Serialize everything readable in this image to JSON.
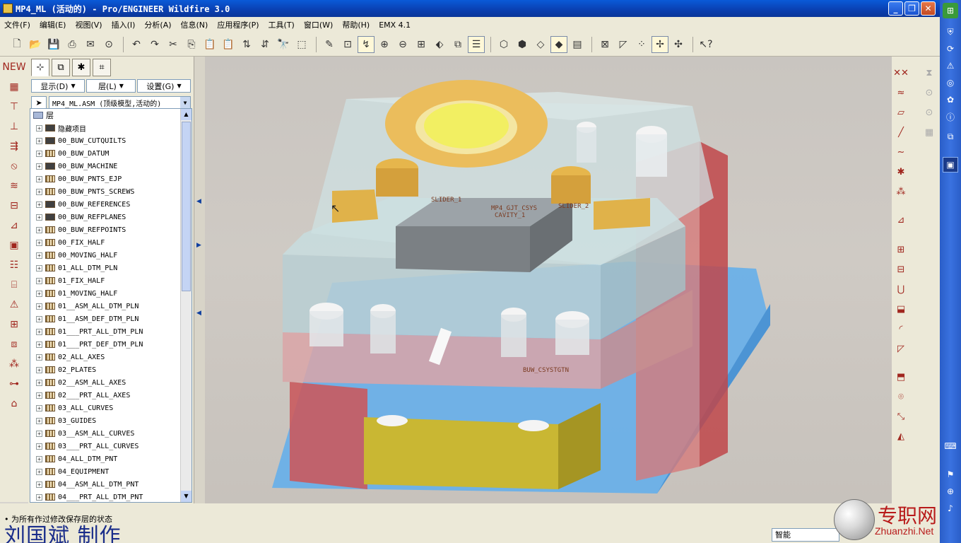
{
  "window": {
    "title": "MP4_ML (活动的) - Pro/ENGINEER Wildfire 3.0"
  },
  "menu": [
    "文件(F)",
    "编辑(E)",
    "视图(V)",
    "插入(I)",
    "分析(A)",
    "信息(N)",
    "应用程序(P)",
    "工具(T)",
    "窗口(W)",
    "帮助(H)",
    "EMX 4.1"
  ],
  "nav": {
    "dropdowns": [
      "显示(D)",
      "层(L)",
      "设置(G)"
    ],
    "model": "MP4_ML.ASM (顶级模型,活动的)",
    "root": "层",
    "layers": [
      {
        "name": "隐藏项目",
        "icon": "dark"
      },
      {
        "name": "00_BUW_CUTQUILTS",
        "icon": "dark"
      },
      {
        "name": "00_BUW_DATUM",
        "icon": "light"
      },
      {
        "name": "00_BUW_MACHINE",
        "icon": "dark"
      },
      {
        "name": "00_BUW_PNTS_EJP",
        "icon": "light"
      },
      {
        "name": "00_BUW_PNTS_SCREWS",
        "icon": "light"
      },
      {
        "name": "00_BUW_REFERENCES",
        "icon": "dark"
      },
      {
        "name": "00_BUW_REFPLANES",
        "icon": "dark"
      },
      {
        "name": "00_BUW_REFPOINTS",
        "icon": "light"
      },
      {
        "name": "00_FIX_HALF",
        "icon": "light"
      },
      {
        "name": "00_MOVING_HALF",
        "icon": "light"
      },
      {
        "name": "01_ALL_DTM_PLN",
        "icon": "light"
      },
      {
        "name": "01_FIX_HALF",
        "icon": "light"
      },
      {
        "name": "01_MOVING_HALF",
        "icon": "light"
      },
      {
        "name": "01__ASM_ALL_DTM_PLN",
        "icon": "light"
      },
      {
        "name": "01__ASM_DEF_DTM_PLN",
        "icon": "light"
      },
      {
        "name": "01___PRT_ALL_DTM_PLN",
        "icon": "light"
      },
      {
        "name": "01___PRT_DEF_DTM_PLN",
        "icon": "light"
      },
      {
        "name": "02_ALL_AXES",
        "icon": "light"
      },
      {
        "name": "02_PLATES",
        "icon": "light"
      },
      {
        "name": "02__ASM_ALL_AXES",
        "icon": "light"
      },
      {
        "name": "02___PRT_ALL_AXES",
        "icon": "light"
      },
      {
        "name": "03_ALL_CURVES",
        "icon": "light"
      },
      {
        "name": "03_GUIDES",
        "icon": "light"
      },
      {
        "name": "03__ASM_ALL_CURVES",
        "icon": "light"
      },
      {
        "name": "03___PRT_ALL_CURVES",
        "icon": "light"
      },
      {
        "name": "04_ALL_DTM_PNT",
        "icon": "light"
      },
      {
        "name": "04_EQUIPMENT",
        "icon": "light"
      },
      {
        "name": "04__ASM_ALL_DTM_PNT",
        "icon": "light"
      },
      {
        "name": "04___PRT_ALL_DTM_PNT",
        "icon": "light"
      }
    ]
  },
  "viewport": {
    "csys_labels": [
      "SLIDER_1",
      "MP4_GJT_CSYS",
      "CAVITY_1",
      "SLIDER_2",
      "BUW_CSYSTGTN"
    ]
  },
  "status": {
    "message": "为所有作过修改保存层的状态",
    "filter": "智能"
  },
  "overlay": {
    "credit": "刘国斌 制作",
    "logo_cn": "专职网",
    "logo_en": "Zhuanzhi.Net"
  }
}
